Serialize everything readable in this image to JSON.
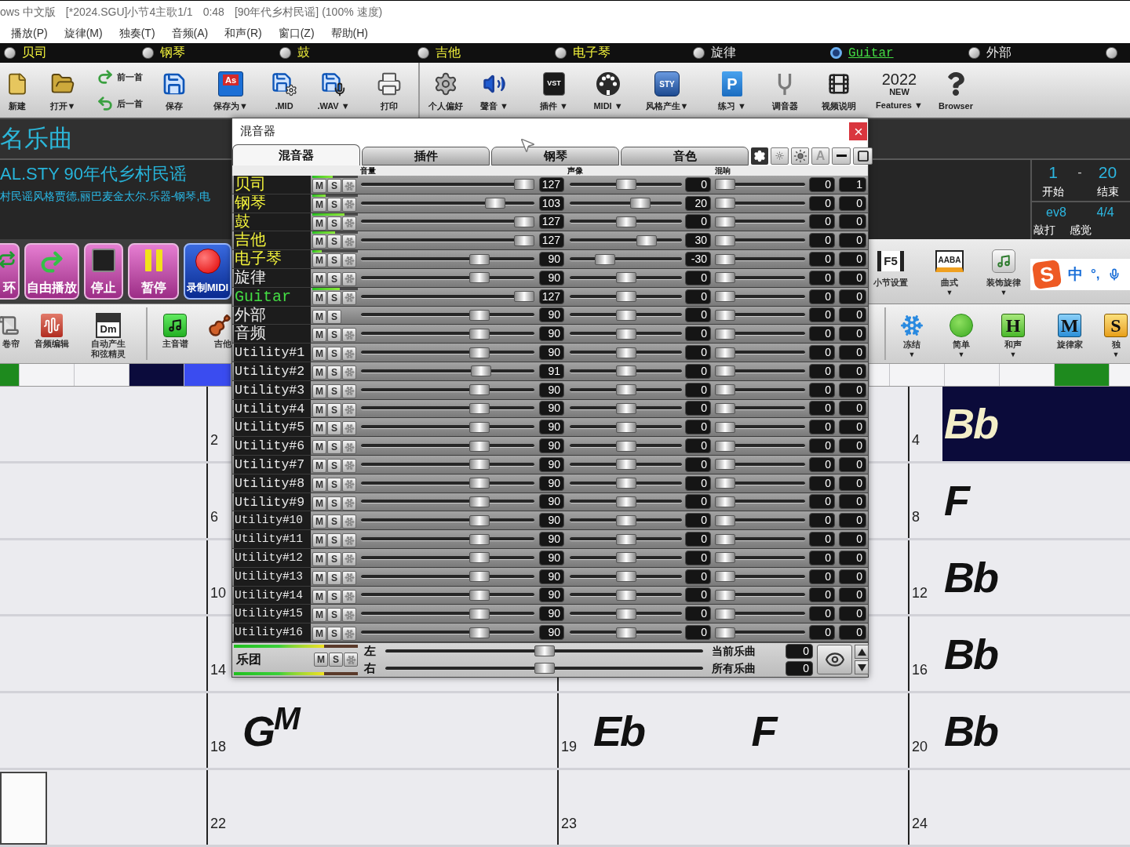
{
  "title_bar": {
    "parts": [
      "ows 中文版",
      "[*2024.SGU]小节4主歌1/1",
      "0:48",
      "[90年代乡村民谣] (100% 速度)"
    ]
  },
  "menu": [
    "播放(P)",
    "旋律(M)",
    "独奏(T)",
    "音频(A)",
    "和声(R)",
    "窗口(Z)",
    "帮助(H)"
  ],
  "tracks": [
    {
      "label": "贝司",
      "color": "#f4f43c",
      "selected": false
    },
    {
      "label": "钢琴",
      "color": "#f4f43c",
      "selected": false
    },
    {
      "label": "鼓",
      "color": "#f4f43c",
      "selected": false
    },
    {
      "label": "吉他",
      "color": "#f4f43c",
      "selected": false
    },
    {
      "label": "电子琴",
      "color": "#f4f43c",
      "selected": false
    },
    {
      "label": "旋律",
      "color": "#e8e8e8",
      "selected": false
    },
    {
      "label": "Guitar",
      "color": "#44dd44",
      "selected": true
    },
    {
      "label": "外部",
      "color": "#e8e8e8",
      "selected": false
    },
    {
      "selected": false
    }
  ],
  "toolbar": [
    {
      "kind": "button",
      "label": "新建"
    },
    {
      "kind": "button",
      "label": "打开▼"
    },
    {
      "kind": "pair",
      "items": [
        "前一首",
        "后一首"
      ]
    },
    {
      "kind": "button",
      "label": "保存"
    },
    {
      "kind": "button",
      "label": "保存为▼",
      "icon_text": "As"
    },
    {
      "kind": "button",
      "label": ".MID"
    },
    {
      "kind": "button",
      "label": ".WAV ▼"
    },
    {
      "kind": "button",
      "label": "打印"
    },
    {
      "kind": "button",
      "label": "个人偏好"
    },
    {
      "kind": "button",
      "label": "聲音 ▼"
    },
    {
      "kind": "button",
      "label": "插件 ▼",
      "icon_text": "VST"
    },
    {
      "kind": "button",
      "label": "MIDI ▼"
    },
    {
      "kind": "button",
      "label": "风格产生▼",
      "icon_text": "STY"
    },
    {
      "kind": "button",
      "label": "练习 ▼",
      "icon_text": "P"
    },
    {
      "kind": "button",
      "label": "调音器"
    },
    {
      "kind": "button",
      "label": "视频说明"
    },
    {
      "kind": "logo",
      "logo": [
        "2022",
        "NEW"
      ],
      "label": "Features ▼"
    },
    {
      "kind": "button",
      "label": "Browser"
    }
  ],
  "song": {
    "title": "名乐曲",
    "style": "AL.STY 90年代乡村民谣",
    "description": "村民谣风格贾德,丽巴麦金太尔.乐器-钢琴,电"
  },
  "song_range": {
    "start": "1",
    "dash": "-",
    "end": "20",
    "start_label": "开始",
    "end_label": "结束",
    "feel_value": "ev8",
    "time_signature": "4/4",
    "column_1_label": "敲打",
    "feel_label": "感觉"
  },
  "transport": [
    {
      "kind": "loop",
      "label": "环"
    },
    {
      "kind": "free_play",
      "label": "自由播放"
    },
    {
      "kind": "stop",
      "label": "停止"
    },
    {
      "kind": "pause",
      "label": "暂停"
    },
    {
      "kind": "record",
      "label": "录制MIDI"
    }
  ],
  "tools_right": [
    {
      "label": "小节设置",
      "icon_text": "F5"
    },
    {
      "label": "曲式",
      "icon_text": "AABA",
      "caret": "▼"
    },
    {
      "label": "装饰旋律",
      "caret": "▼"
    }
  ],
  "ime_bar": {
    "logo": "S",
    "items": [
      "中",
      "°,"
    ]
  },
  "toolbar2_left": [
    {
      "label": "卷帘"
    },
    {
      "label": "音频编辑"
    },
    {
      "label": "自动产生和弦精灵",
      "icon_text": "Dm"
    },
    {
      "label": "主音谱"
    },
    {
      "label": "吉他"
    }
  ],
  "toolbar2_right": [
    {
      "label": "冻结",
      "caret": "▼"
    },
    {
      "label": "简单",
      "caret": "▼"
    },
    {
      "label": "和声",
      "caret": "▼",
      "icon_text": "H"
    },
    {
      "label": "旋律家",
      "icon_text": "M"
    },
    {
      "label": "独",
      "caret": "▼",
      "icon_text": "S"
    }
  ],
  "timeline": {
    "left": [
      {
        "color": "#1e8a1e"
      },
      {
        "color": "#f4f4f6"
      },
      {
        "color": "#f4f4f6"
      },
      {
        "color": "#0b0b3c"
      },
      {
        "color": "#3a4cf0"
      }
    ],
    "right": [
      {
        "color": "#f4f4f6"
      },
      {
        "color": "#f4f4f6"
      },
      {
        "color": "#f4f4f6"
      },
      {
        "color": "#f4f4f6"
      },
      {
        "color": "#1e8a1e"
      },
      {
        "color": "#f4f4f6"
      }
    ]
  },
  "chord_sheet": {
    "rows": [
      {
        "cells": [
          {
            "kind": "empty"
          },
          {
            "kind": "bar",
            "bar": "2"
          },
          {
            "kind": "empty"
          },
          {
            "kind": "current",
            "bar": "4",
            "chords": [
              "Bb"
            ]
          }
        ]
      },
      {
        "cells": [
          {
            "kind": "empty"
          },
          {
            "kind": "bar",
            "bar": "6"
          },
          {
            "kind": "empty"
          },
          {
            "kind": "bar",
            "bar": "8",
            "chords": [
              "F"
            ]
          }
        ]
      },
      {
        "cells": [
          {
            "kind": "empty"
          },
          {
            "kind": "bar",
            "bar": "10"
          },
          {
            "kind": "empty"
          },
          {
            "kind": "bar",
            "bar": "12",
            "chords": [
              "Bb"
            ]
          }
        ]
      },
      {
        "cells": [
          {
            "kind": "empty"
          },
          {
            "kind": "bar",
            "bar": "14"
          },
          {
            "kind": "empty"
          },
          {
            "kind": "bar",
            "bar": "16",
            "chords": [
              "Bb"
            ]
          }
        ]
      },
      {
        "cells": [
          {
            "kind": "empty"
          },
          {
            "kind": "bar",
            "bar": "18",
            "chords": [
              "G$^{M}$"
            ]
          },
          {
            "kind": "bar",
            "bar": "19",
            "chords": [
              "Eb",
              "F"
            ]
          },
          {
            "kind": "bar",
            "bar": "20",
            "chords": [
              "Bb"
            ]
          }
        ]
      },
      {
        "cells": [
          {
            "kind": "cursor"
          },
          {
            "kind": "bar",
            "bar": "22"
          },
          {
            "kind": "bar",
            "bar": "23"
          },
          {
            "kind": "bar",
            "bar": "24"
          }
        ]
      }
    ]
  },
  "mixer": {
    "title": "混音器",
    "tabs": [
      {
        "label": "混音器",
        "selected": true
      },
      {
        "label": "插件",
        "selected": false
      },
      {
        "label": "钢琴",
        "selected": false
      },
      {
        "label": "音色",
        "selected": false
      }
    ],
    "text_button": "A",
    "columns": [
      "音量",
      "声像",
      "混响"
    ],
    "channels": [
      {
        "name": "贝司",
        "kind": "filled",
        "meter": {
          "level": 0.45
        },
        "buttons": [
          "M",
          "S"
        ],
        "fx_button": true,
        "volume": {
          "value": "127",
          "level": 1
        },
        "pan": {
          "value": "0",
          "level": 0.5
        },
        "reverb": {
          "value": "0",
          "level": 0
        },
        "column_5": "1"
      },
      {
        "name": "钢琴",
        "kind": "filled",
        "meter": {
          "level": 0.3
        },
        "buttons": [
          "M",
          "S"
        ],
        "fx_button": true,
        "volume": {
          "value": "103",
          "level": 0.81
        },
        "pan": {
          "value": "20",
          "level": 0.66
        },
        "reverb": {
          "value": "0",
          "level": 0
        },
        "column_5": "0"
      },
      {
        "name": "鼓",
        "kind": "filled",
        "meter": {
          "level": 0.7
        },
        "buttons": [
          "M",
          "S"
        ],
        "fx_button": true,
        "volume": {
          "value": "127",
          "level": 1
        },
        "pan": {
          "value": "0",
          "level": 0.5
        },
        "reverb": {
          "value": "0",
          "level": 0
        },
        "column_5": "0"
      },
      {
        "name": "吉他",
        "kind": "filled",
        "meter": {
          "level": 0.5
        },
        "buttons": [
          "M",
          "S"
        ],
        "fx_button": true,
        "volume": {
          "value": "127",
          "level": 1
        },
        "pan": {
          "value": "30",
          "level": 0.73
        },
        "reverb": {
          "value": "0",
          "level": 0
        },
        "column_5": "0"
      },
      {
        "name": "电子琴",
        "kind": "filled",
        "meter": {
          "level": 0.2
        },
        "buttons": [
          "M",
          "S"
        ],
        "fx_button": true,
        "volume": {
          "value": "90",
          "level": 0.71
        },
        "pan": {
          "value": "-30",
          "level": 0.27
        },
        "reverb": {
          "value": "0",
          "level": 0
        },
        "column_5": "0"
      },
      {
        "name": "旋律",
        "kind": "empty",
        "buttons": [
          "M",
          "S"
        ],
        "fx_button": true,
        "volume": {
          "value": "90",
          "level": 0.71
        },
        "pan": {
          "value": "0",
          "level": 0.5
        },
        "reverb": {
          "value": "0",
          "level": 0
        },
        "column_5": "0"
      },
      {
        "name": "Guitar",
        "kind": "current",
        "meter": {
          "level": 0.6
        },
        "buttons": [
          "M",
          "S"
        ],
        "fx_button": true,
        "volume": {
          "value": "127",
          "level": 1
        },
        "pan": {
          "value": "0",
          "level": 0.5
        },
        "reverb": {
          "value": "0",
          "level": 0
        },
        "column_5": "0"
      },
      {
        "name": "外部",
        "kind": "empty",
        "buttons": [
          "M",
          "S"
        ],
        "fx_button": false,
        "volume": {
          "value": "90",
          "level": 0.71
        },
        "pan": {
          "value": "0",
          "level": 0.5
        },
        "reverb": {
          "value": "0",
          "level": 0
        },
        "column_5": "0"
      },
      {
        "name": "音频",
        "kind": "empty",
        "buttons": [
          "M",
          "S"
        ],
        "fx_button": true,
        "volume": {
          "value": "90",
          "level": 0.71
        },
        "pan": {
          "value": "0",
          "level": 0.5
        },
        "reverb": {
          "value": "0",
          "level": 0
        },
        "column_5": "0"
      },
      {
        "name": "Utility#1",
        "kind": "empty",
        "buttons": [
          "M",
          "S"
        ],
        "fx_button": true,
        "volume": {
          "value": "90",
          "level": 0.71
        },
        "pan": {
          "value": "0",
          "level": 0.5
        },
        "reverb": {
          "value": "0",
          "level": 0
        },
        "column_5": "0"
      },
      {
        "name": "Utility#2",
        "kind": "empty",
        "buttons": [
          "M",
          "S"
        ],
        "fx_button": true,
        "volume": {
          "value": "91",
          "level": 0.72
        },
        "pan": {
          "value": "0",
          "level": 0.5
        },
        "reverb": {
          "value": "0",
          "level": 0
        },
        "column_5": "0"
      },
      {
        "name": "Utility#3",
        "kind": "empty",
        "buttons": [
          "M",
          "S"
        ],
        "fx_button": true,
        "volume": {
          "value": "90",
          "level": 0.71
        },
        "pan": {
          "value": "0",
          "level": 0.5
        },
        "reverb": {
          "value": "0",
          "level": 0
        },
        "column_5": "0"
      },
      {
        "name": "Utility#4",
        "kind": "empty",
        "buttons": [
          "M",
          "S"
        ],
        "fx_button": true,
        "volume": {
          "value": "90",
          "level": 0.71
        },
        "pan": {
          "value": "0",
          "level": 0.5
        },
        "reverb": {
          "value": "0",
          "level": 0
        },
        "column_5": "0"
      },
      {
        "name": "Utility#5",
        "kind": "empty",
        "buttons": [
          "M",
          "S"
        ],
        "fx_button": true,
        "volume": {
          "value": "90",
          "level": 0.71
        },
        "pan": {
          "value": "0",
          "level": 0.5
        },
        "reverb": {
          "value": "0",
          "level": 0
        },
        "column_5": "0"
      },
      {
        "name": "Utility#6",
        "kind": "empty",
        "buttons": [
          "M",
          "S"
        ],
        "fx_button": true,
        "volume": {
          "value": "90",
          "level": 0.71
        },
        "pan": {
          "value": "0",
          "level": 0.5
        },
        "reverb": {
          "value": "0",
          "level": 0
        },
        "column_5": "0"
      },
      {
        "name": "Utility#7",
        "kind": "empty",
        "buttons": [
          "M",
          "S"
        ],
        "fx_button": true,
        "volume": {
          "value": "90",
          "level": 0.71
        },
        "pan": {
          "value": "0",
          "level": 0.5
        },
        "reverb": {
          "value": "0",
          "level": 0
        },
        "column_5": "0"
      },
      {
        "name": "Utility#8",
        "kind": "empty",
        "buttons": [
          "M",
          "S"
        ],
        "fx_button": true,
        "volume": {
          "value": "90",
          "level": 0.71
        },
        "pan": {
          "value": "0",
          "level": 0.5
        },
        "reverb": {
          "value": "0",
          "level": 0
        },
        "column_5": "0"
      },
      {
        "name": "Utility#9",
        "kind": "empty",
        "buttons": [
          "M",
          "S"
        ],
        "fx_button": true,
        "volume": {
          "value": "90",
          "level": 0.71
        },
        "pan": {
          "value": "0",
          "level": 0.5
        },
        "reverb": {
          "value": "0",
          "level": 0
        },
        "column_5": "0"
      },
      {
        "name": "Utility#10",
        "kind": "empty",
        "buttons": [
          "M",
          "S"
        ],
        "fx_button": true,
        "volume": {
          "value": "90",
          "level": 0.71
        },
        "pan": {
          "value": "0",
          "level": 0.5
        },
        "reverb": {
          "value": "0",
          "level": 0
        },
        "column_5": "0"
      },
      {
        "name": "Utility#11",
        "kind": "empty",
        "buttons": [
          "M",
          "S"
        ],
        "fx_button": true,
        "volume": {
          "value": "90",
          "level": 0.71
        },
        "pan": {
          "value": "0",
          "level": 0.5
        },
        "reverb": {
          "value": "0",
          "level": 0
        },
        "column_5": "0"
      },
      {
        "name": "Utility#12",
        "kind": "empty",
        "buttons": [
          "M",
          "S"
        ],
        "fx_button": true,
        "volume": {
          "value": "90",
          "level": 0.71
        },
        "pan": {
          "value": "0",
          "level": 0.5
        },
        "reverb": {
          "value": "0",
          "level": 0
        },
        "column_5": "0"
      },
      {
        "name": "Utility#13",
        "kind": "empty",
        "buttons": [
          "M",
          "S"
        ],
        "fx_button": true,
        "volume": {
          "value": "90",
          "level": 0.71
        },
        "pan": {
          "value": "0",
          "level": 0.5
        },
        "reverb": {
          "value": "0",
          "level": 0
        },
        "column_5": "0"
      },
      {
        "name": "Utility#14",
        "kind": "empty",
        "buttons": [
          "M",
          "S"
        ],
        "fx_button": true,
        "volume": {
          "value": "90",
          "level": 0.71
        },
        "pan": {
          "value": "0",
          "level": 0.5
        },
        "reverb": {
          "value": "0",
          "level": 0
        },
        "column_5": "0"
      },
      {
        "name": "Utility#15",
        "kind": "empty",
        "buttons": [
          "M",
          "S"
        ],
        "fx_button": true,
        "volume": {
          "value": "90",
          "level": 0.71
        },
        "pan": {
          "value": "0",
          "level": 0.5
        },
        "reverb": {
          "value": "0",
          "level": 0
        },
        "column_5": "0"
      },
      {
        "name": "Utility#16",
        "kind": "empty",
        "buttons": [
          "M",
          "S"
        ],
        "fx_button": true,
        "volume": {
          "value": "90",
          "level": 0.71
        },
        "pan": {
          "value": "0",
          "level": 0.5
        },
        "reverb": {
          "value": "0",
          "level": 0
        },
        "column_5": "0"
      }
    ],
    "band": {
      "label": "乐团",
      "buttons": [
        "M",
        "S"
      ],
      "meters": [
        {
          "level": 0.73
        },
        {
          "level": 0.73
        }
      ]
    },
    "master": [
      {
        "side": "左",
        "level": 0.5,
        "label": "当前乐曲",
        "value": "0"
      },
      {
        "side": "右",
        "level": 0.5,
        "label": "所有乐曲",
        "value": "0"
      }
    ]
  }
}
